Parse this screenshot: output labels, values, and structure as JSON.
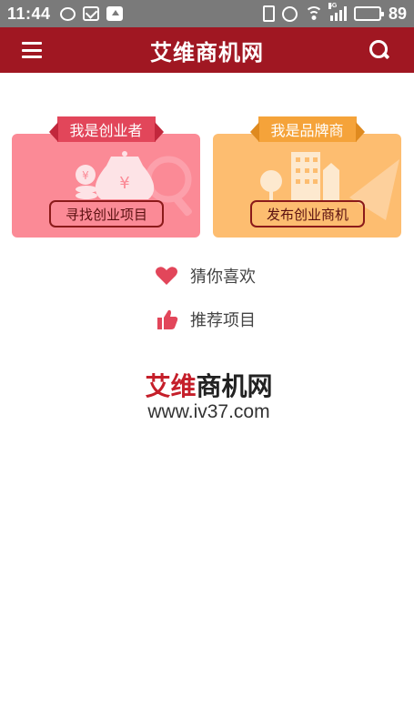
{
  "status_bar": {
    "time": "11:44",
    "network_tag": "4G",
    "battery_percent": "89",
    "battery_level": 0.89
  },
  "header": {
    "title": "艾维商机网"
  },
  "cards": [
    {
      "ribbon": "我是创业者",
      "button": "寻找创业项目",
      "theme": "#fb8a96"
    },
    {
      "ribbon": "我是品牌商",
      "button": "发布创业商机",
      "theme": "#fdbd70"
    }
  ],
  "links": [
    {
      "label": "猜你喜欢",
      "icon": "heart-icon"
    },
    {
      "label": "推荐项目",
      "icon": "thumbs-up-icon"
    }
  ],
  "footer": {
    "logo_part1": "艾维",
    "logo_part2": "商机网",
    "url": "www.iv37.com"
  },
  "colors": {
    "header_bg": "#a01722",
    "accent_red": "#e2465a",
    "accent_orange": "#f5a33a"
  }
}
